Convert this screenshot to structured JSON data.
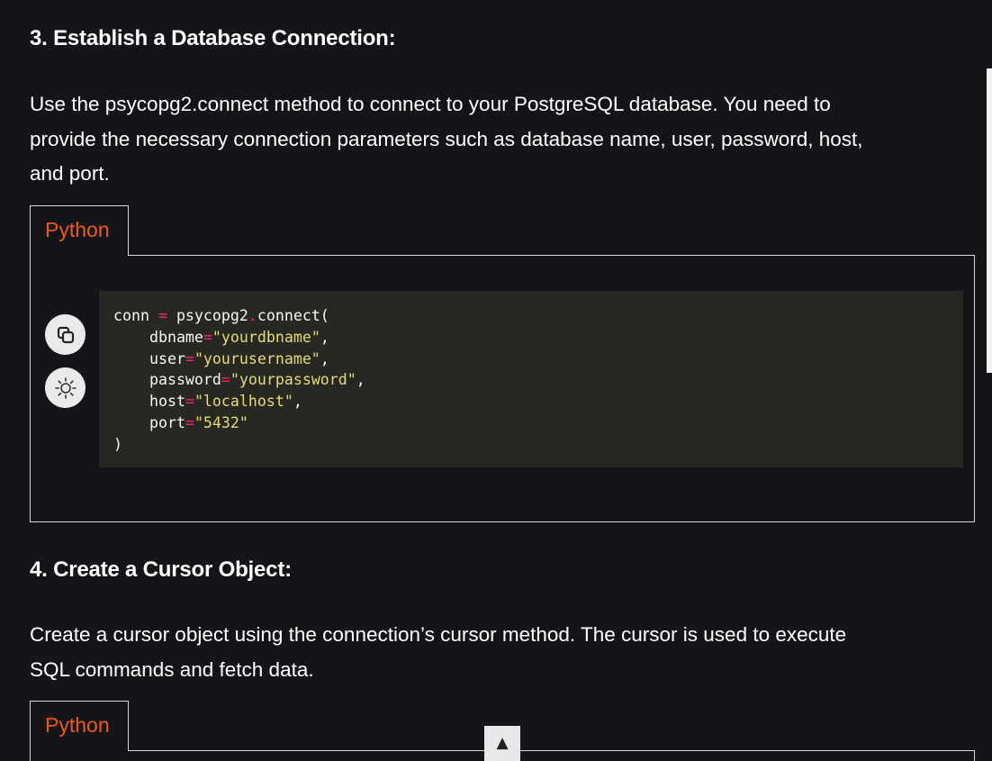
{
  "section3": {
    "heading": "3. Establish a Database Connection:",
    "para_lines": [
      "Use the psycopg2.connect method to connect to your PostgreSQL database. You need to",
      "provide the necessary connection parameters such as database name, user, password, host,",
      "and port."
    ],
    "tab_label": "Python",
    "code": [
      {
        "pre": "conn ",
        "op": "=",
        "post": " psycopg2",
        "op2": ".",
        "post2": "connect("
      },
      {
        "key": "dbname",
        "val": "\"yourdbname\"",
        "tail": ","
      },
      {
        "key": "user",
        "val": "\"yourusername\"",
        "tail": ","
      },
      {
        "key": "password",
        "val": "\"yourpassword\"",
        "tail": ","
      },
      {
        "key": "host",
        "val": "\"localhost\"",
        "tail": ","
      },
      {
        "key": "port",
        "val": "\"5432\"",
        "tail": ""
      },
      {
        "close": ")"
      }
    ]
  },
  "section4": {
    "heading": "4. Create a Cursor Object:",
    "para_lines": [
      "Create a cursor object using the connection’s cursor method. The cursor is used to execute",
      "SQL commands and fetch data."
    ],
    "tab_label": "Python"
  },
  "controls": {
    "copy_icon": "copy-icon",
    "theme_icon": "sun-icon",
    "scroll_top_glyph": "▲"
  }
}
